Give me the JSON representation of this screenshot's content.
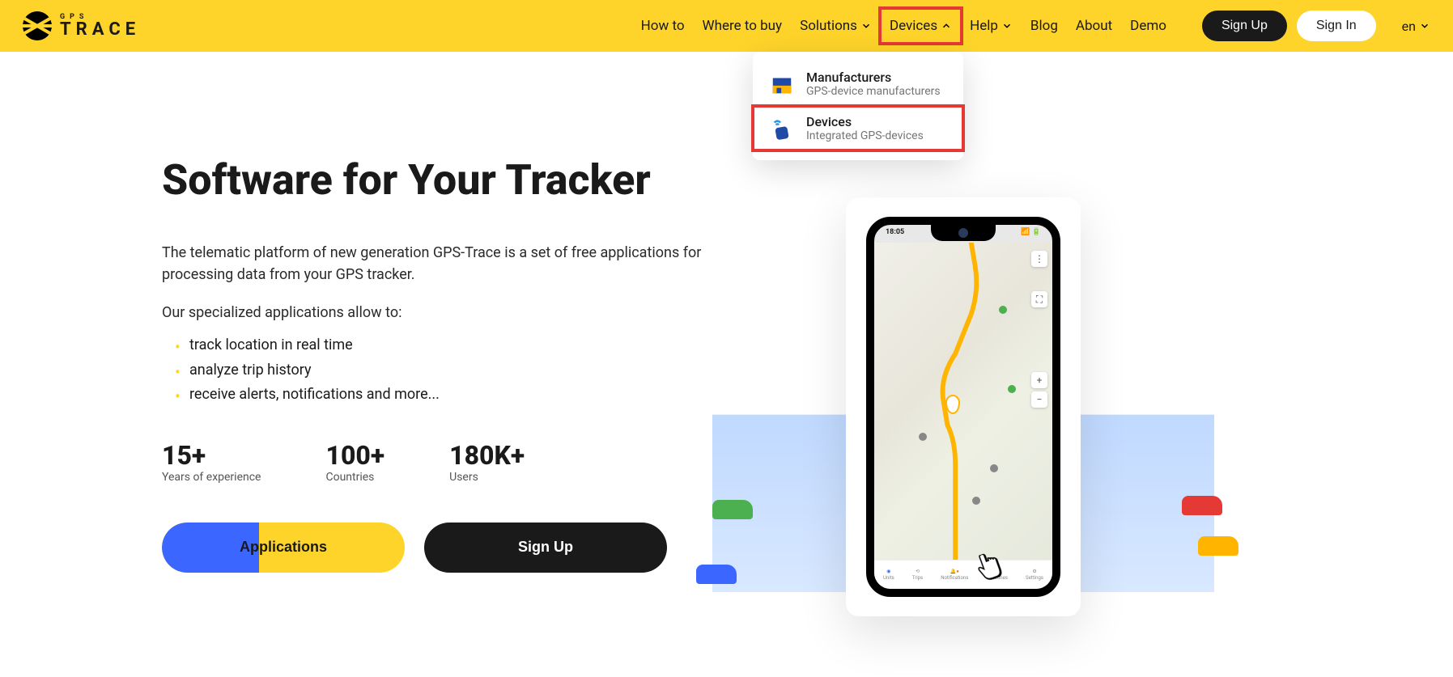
{
  "logo": {
    "line1": "GPS",
    "line2": "TRACE"
  },
  "nav": {
    "how_to": "How to",
    "where_to_buy": "Where to buy",
    "solutions": "Solutions",
    "devices": "Devices",
    "help": "Help",
    "blog": "Blog",
    "about": "About",
    "demo": "Demo"
  },
  "auth": {
    "sign_up": "Sign Up",
    "sign_in": "Sign In"
  },
  "lang": "en",
  "dropdown": {
    "items": [
      {
        "title": "Manufacturers",
        "sub": "GPS-device manufacturers"
      },
      {
        "title": "Devices",
        "sub": "Integrated GPS-devices"
      }
    ]
  },
  "hero": {
    "heading": "Software for Your Tracker",
    "desc1": "The telematic platform of new generation GPS-Trace is a set of free applications for processing data from your GPS tracker.",
    "desc2": "Our specialized applications allow to:",
    "bullets": [
      "track location in real time",
      "analyze trip history",
      "receive alerts, notifications and more..."
    ],
    "stats": [
      {
        "num": "15+",
        "label": "Years of experience"
      },
      {
        "num": "100+",
        "label": "Countries"
      },
      {
        "num": "180K+",
        "label": "Users"
      }
    ],
    "btn_applications": "Applications",
    "btn_signup": "Sign Up"
  },
  "phone": {
    "time": "18:05",
    "tabs": [
      "Units",
      "Trips",
      "Notifications",
      "Geozones",
      "Settings"
    ]
  }
}
